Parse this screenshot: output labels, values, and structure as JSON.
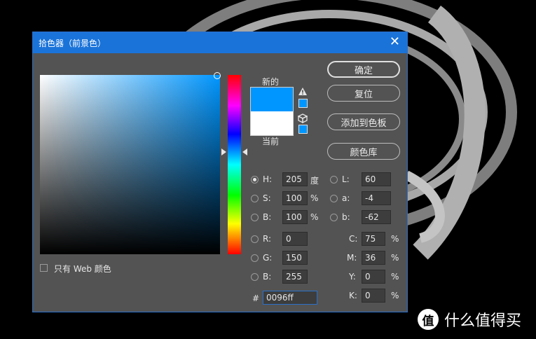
{
  "dialog": {
    "title": "拾色器（前景色）",
    "close_glyph": "✕",
    "new_label": "新的",
    "current_label": "当前",
    "web_only_label": "只有 Web 颜色",
    "buttons": {
      "ok": "确定",
      "reset": "复位",
      "add_swatch": "添加到色板",
      "libraries": "颜色库"
    },
    "hsb": {
      "h_label": "H:",
      "h_value": "205",
      "h_unit": "度",
      "s_label": "S:",
      "s_value": "100",
      "s_unit": "%",
      "b_label": "B:",
      "b_value": "100",
      "b_unit": "%"
    },
    "rgb": {
      "r_label": "R:",
      "r_value": "0",
      "g_label": "G:",
      "g_value": "150",
      "b_label": "B:",
      "b_value": "255"
    },
    "lab": {
      "l_label": "L:",
      "l_value": "60",
      "a_label": "a:",
      "a_value": "-4",
      "b_label": "b:",
      "b_value": "-62"
    },
    "cmyk": {
      "c_label": "C:",
      "c_value": "75",
      "c_unit": "%",
      "m_label": "M:",
      "m_value": "36",
      "m_unit": "%",
      "y_label": "Y:",
      "y_value": "0",
      "y_unit": "%",
      "k_label": "K:",
      "k_value": "0",
      "k_unit": "%"
    },
    "hex_label": "#",
    "hex_value": "0096ff",
    "colors": {
      "new": "#0096ff",
      "current": "#ffffff",
      "accent": "#1a73d9",
      "panel": "#535353"
    },
    "icons": {
      "gamut_warning": "warning-triangle-icon",
      "web_safe": "cube-icon"
    }
  },
  "watermark": {
    "logo": "值",
    "text": "什么值得买"
  }
}
